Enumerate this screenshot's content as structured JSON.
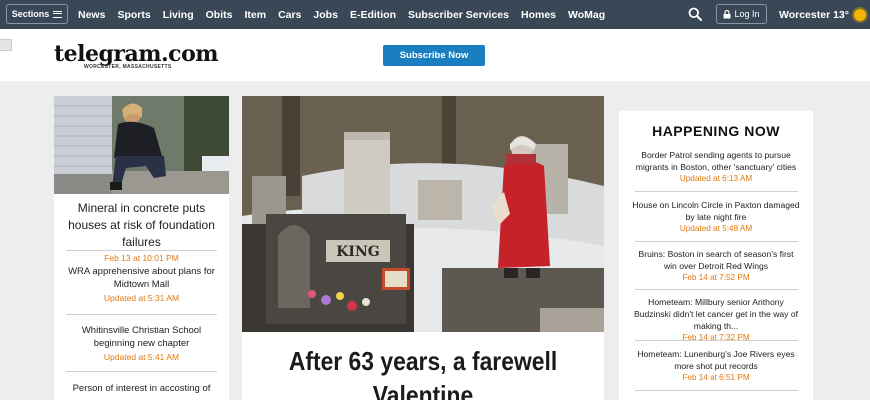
{
  "nav": {
    "sections_label": "Sections",
    "links": [
      "News",
      "Sports",
      "Living",
      "Obits",
      "Item",
      "Cars",
      "Jobs",
      "E-Edition",
      "Subscriber Services",
      "Homes",
      "WoMag"
    ],
    "login_label": "Log In",
    "weather": "Worcester 13°"
  },
  "header": {
    "logo": "telegram.com",
    "logo_sub": "WORCESTER, MASSACHUSETTS",
    "subscribe_label": "Subscribe Now"
  },
  "left": {
    "stories": [
      {
        "headline": "Mineral in concrete puts houses at risk of foundation failures",
        "time": "Feb 13 at 10:01 PM"
      },
      {
        "headline": "WRA apprehensive about plans for Midtown Mall",
        "time": "Updated at 5:31 AM"
      },
      {
        "headline": "Whitinsville Christian School beginning new chapter",
        "time": "Updated at 5:41 AM"
      },
      {
        "headline": "Person of interest in accosting of",
        "time": ""
      }
    ]
  },
  "center": {
    "image_text": "KING",
    "headline": "After 63 years, a farewell Valentine"
  },
  "right": {
    "title": "HAPPENING NOW",
    "stories": [
      {
        "headline": "Border Patrol sending agents to pursue migrants in Boston, other 'sanctuary' cities",
        "time": "Updated at 6:13 AM"
      },
      {
        "headline": "House on Lincoln Circle in Paxton damaged by late night fire",
        "time": "Updated at 5:48 AM"
      },
      {
        "headline": "Bruins: Boston in search of season's first win over Detroit Red Wings",
        "time": "Feb 14 at 7:52 PM"
      },
      {
        "headline": "Hometeam: Millbury senior Anthony Budzinski didn't let cancer get in the way of making th...",
        "time": "Feb 14 at 7:32 PM"
      },
      {
        "headline": "Hometeam: Lunenburg's Joe Rivers eyes more shot put records",
        "time": "Feb 14 at 6:51 PM"
      }
    ]
  },
  "colors": {
    "nav_bg": "#3a4756",
    "accent": "#1a7fc1",
    "timestamp": "#e07a10"
  }
}
